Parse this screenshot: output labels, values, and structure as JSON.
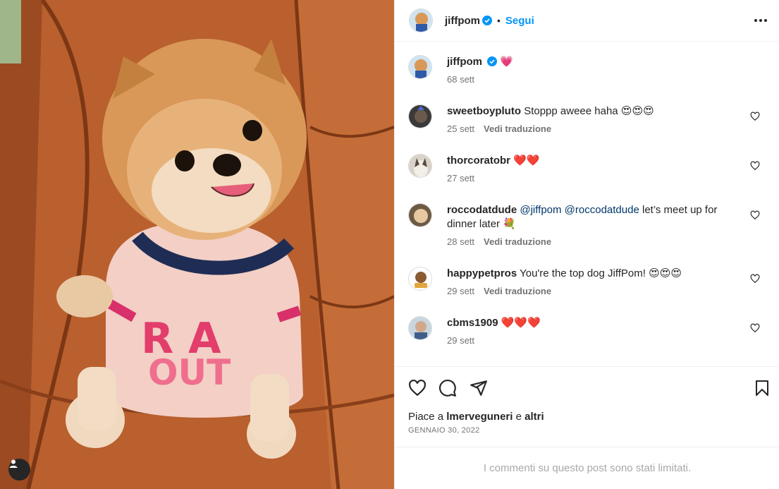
{
  "post": {
    "username": "jiffpom",
    "follow_label": "Segui",
    "separator": "•"
  },
  "comments": [
    {
      "user": "jiffpom",
      "text": "💗",
      "time": "68 sett",
      "translate": ""
    },
    {
      "user": "sweetboypluto",
      "text": "Stoppp aweee haha 😍😍😍",
      "time": "25 sett",
      "translate": "Vedi traduzione"
    },
    {
      "user": "thorcoratobr",
      "text": "❤️❤️",
      "time": "27 sett",
      "translate": ""
    },
    {
      "user": "roccodatdude",
      "mention1": "@jiffpom",
      "mention2": "@roccodatdude",
      "text": "let’s meet up for dinner later 💐",
      "time": "28 sett",
      "translate": "Vedi traduzione"
    },
    {
      "user": "happypetpros",
      "text": "You're the top dog JiffPom! 😍😍😍",
      "time": "29 sett",
      "translate": "Vedi traduzione"
    },
    {
      "user": "cbms1909",
      "text": "❤️❤️❤️",
      "time": "29 sett",
      "translate": ""
    }
  ],
  "likes": {
    "prefix": "Piace a",
    "user": "lmerveguneri",
    "conj": "e",
    "others": "altri"
  },
  "date": "GENNAIO 30, 2022",
  "limited_notice": "I commenti su questo post sono stati limitati.",
  "icons": [
    "verified-icon",
    "more-icon",
    "heart-icon",
    "comment-icon",
    "share-icon",
    "bookmark-icon",
    "user-tag-icon"
  ],
  "colors": {
    "accent": "#0095f6",
    "verified": "#0095f6",
    "mention": "#00376b"
  }
}
